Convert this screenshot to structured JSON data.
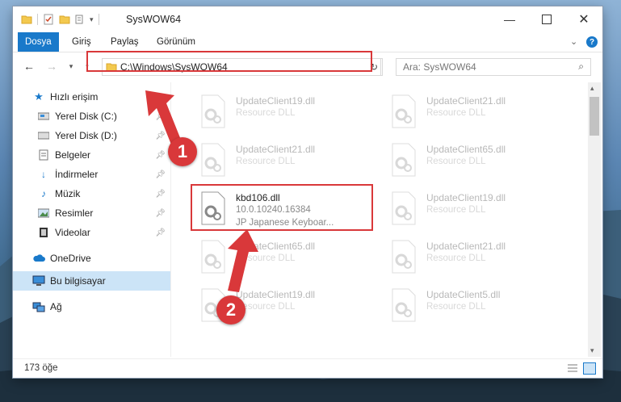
{
  "window": {
    "title": "SysWOW64",
    "controls": [
      "minimize-icon",
      "maximize-icon",
      "close-icon"
    ]
  },
  "ribbon": {
    "tabs": [
      {
        "label": "Dosya",
        "active": true
      },
      {
        "label": "Giriş",
        "active": false
      },
      {
        "label": "Paylaş",
        "active": false
      },
      {
        "label": "Görünüm",
        "active": false
      }
    ],
    "help": "?"
  },
  "navigation": {
    "address": "C:\\Windows\\SysWOW64",
    "search_placeholder": "Ara: SysWOW64"
  },
  "sidebar": {
    "quick_access": "Hızlı erişim",
    "items": [
      {
        "label": "Yerel Disk (C:)",
        "icon": "drive-icon"
      },
      {
        "label": "Yerel Disk (D:)",
        "icon": "drive-icon"
      },
      {
        "label": "Belgeler",
        "icon": "documents-icon"
      },
      {
        "label": "İndirmeler",
        "icon": "download-icon"
      },
      {
        "label": "Müzik",
        "icon": "music-icon"
      },
      {
        "label": "Resimler",
        "icon": "pictures-icon"
      },
      {
        "label": "Videolar",
        "icon": "video-icon"
      }
    ],
    "onedrive": "OneDrive",
    "this_pc": "Bu bilgisayar",
    "network": "Ağ"
  },
  "files": {
    "left_column": [
      {
        "name": "UpdateClient19.dll",
        "type": "Resource DLL"
      },
      {
        "name": "UpdateClient21.dll",
        "type": "Resource DLL"
      },
      {
        "name": "UpdateClient65.dll",
        "type": "Resource DLL"
      },
      {
        "name": "UpdateClient19.dll",
        "type": "Resource DLL"
      }
    ],
    "right_column": [
      {
        "name": "UpdateClient21.dll",
        "type": "Resource DLL"
      },
      {
        "name": "UpdateClient65.dll",
        "type": "Resource DLL"
      },
      {
        "name": "UpdateClient19.dll",
        "type": "Resource DLL"
      },
      {
        "name": "UpdateClient21.dll",
        "type": "Resource DLL"
      },
      {
        "name": "UpdateClient5.dll",
        "type": "Resource DLL"
      }
    ],
    "highlighted": {
      "name": "kbd106.dll",
      "version": "10.0.10240.16384",
      "description": "JP Japanese Keyboar..."
    }
  },
  "status": {
    "count": "173 öğe"
  },
  "annotations": {
    "badge1": "1",
    "badge2": "2",
    "color": "#d9383a"
  }
}
